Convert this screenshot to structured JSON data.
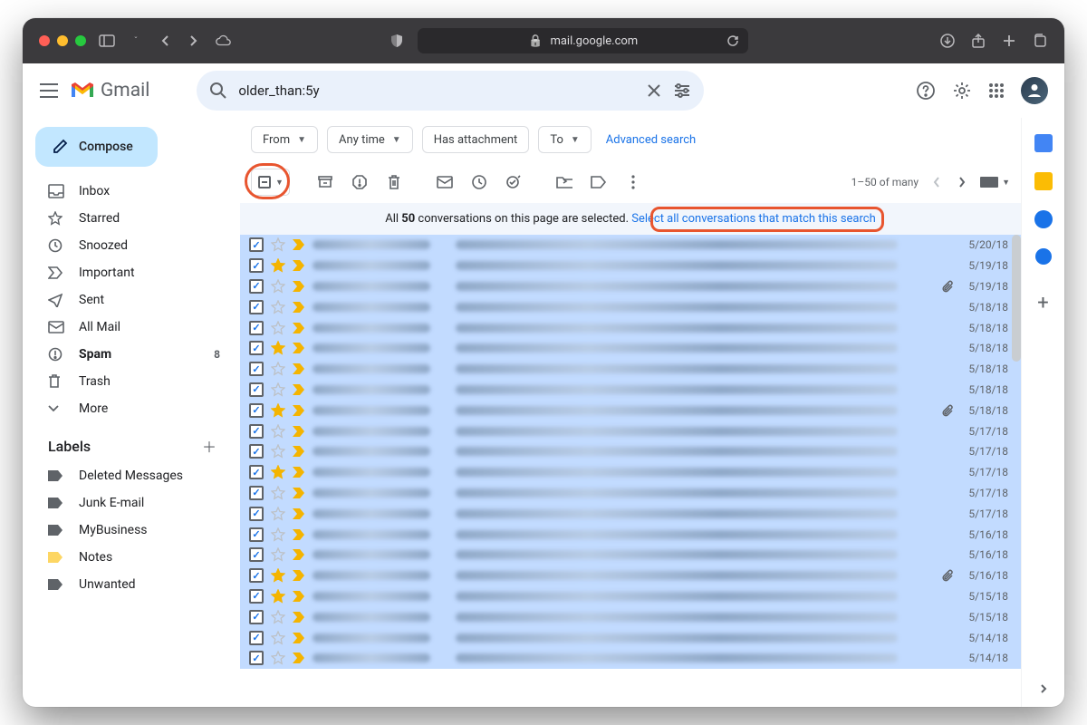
{
  "browser": {
    "url": "mail.google.com"
  },
  "app": {
    "name": "Gmail"
  },
  "search": {
    "query": "older_than:5y"
  },
  "compose": {
    "label": "Compose"
  },
  "nav": [
    {
      "id": "inbox",
      "label": "Inbox",
      "icon": "inbox"
    },
    {
      "id": "starred",
      "label": "Starred",
      "icon": "star"
    },
    {
      "id": "snoozed",
      "label": "Snoozed",
      "icon": "clock"
    },
    {
      "id": "important",
      "label": "Important",
      "icon": "important"
    },
    {
      "id": "sent",
      "label": "Sent",
      "icon": "send"
    },
    {
      "id": "allmail",
      "label": "All Mail",
      "icon": "mail"
    },
    {
      "id": "spam",
      "label": "Spam",
      "icon": "spam",
      "bold": true,
      "badge": "8"
    },
    {
      "id": "trash",
      "label": "Trash",
      "icon": "trash"
    },
    {
      "id": "more",
      "label": "More",
      "icon": "chevdown"
    }
  ],
  "labels_header": "Labels",
  "labels": [
    {
      "label": "Deleted Messages"
    },
    {
      "label": "Junk E-mail"
    },
    {
      "label": "MyBusiness"
    },
    {
      "label": "Notes",
      "color": "#fdd663"
    },
    {
      "label": "Unwanted"
    }
  ],
  "chips": {
    "from": "From",
    "anytime": "Any time",
    "hasatt": "Has attachment",
    "to": "To",
    "advanced": "Advanced search"
  },
  "pager": {
    "range": "1–50 of many"
  },
  "banner": {
    "prefix": "All ",
    "count": "50",
    "suffix": " conversations on this page are selected.  ",
    "link": "Select all conversations that match this search"
  },
  "rows": [
    {
      "star": false,
      "att": false,
      "date": "5/20/18"
    },
    {
      "star": true,
      "att": false,
      "date": "5/19/18"
    },
    {
      "star": false,
      "att": true,
      "date": "5/19/18"
    },
    {
      "star": false,
      "att": false,
      "date": "5/18/18"
    },
    {
      "star": false,
      "att": false,
      "date": "5/18/18"
    },
    {
      "star": true,
      "att": false,
      "date": "5/18/18"
    },
    {
      "star": false,
      "att": false,
      "date": "5/18/18"
    },
    {
      "star": false,
      "att": false,
      "date": "5/18/18"
    },
    {
      "star": true,
      "att": true,
      "date": "5/18/18"
    },
    {
      "star": false,
      "att": false,
      "date": "5/17/18"
    },
    {
      "star": false,
      "att": false,
      "date": "5/17/18"
    },
    {
      "star": true,
      "att": false,
      "date": "5/17/18"
    },
    {
      "star": false,
      "att": false,
      "date": "5/17/18"
    },
    {
      "star": false,
      "att": false,
      "date": "5/17/18"
    },
    {
      "star": false,
      "att": false,
      "date": "5/16/18"
    },
    {
      "star": false,
      "att": false,
      "date": "5/16/18"
    },
    {
      "star": true,
      "att": true,
      "date": "5/16/18"
    },
    {
      "star": true,
      "att": false,
      "date": "5/15/18"
    },
    {
      "star": false,
      "att": false,
      "date": "5/15/18"
    },
    {
      "star": false,
      "att": false,
      "date": "5/14/18"
    },
    {
      "star": false,
      "att": false,
      "date": "5/14/18"
    }
  ]
}
